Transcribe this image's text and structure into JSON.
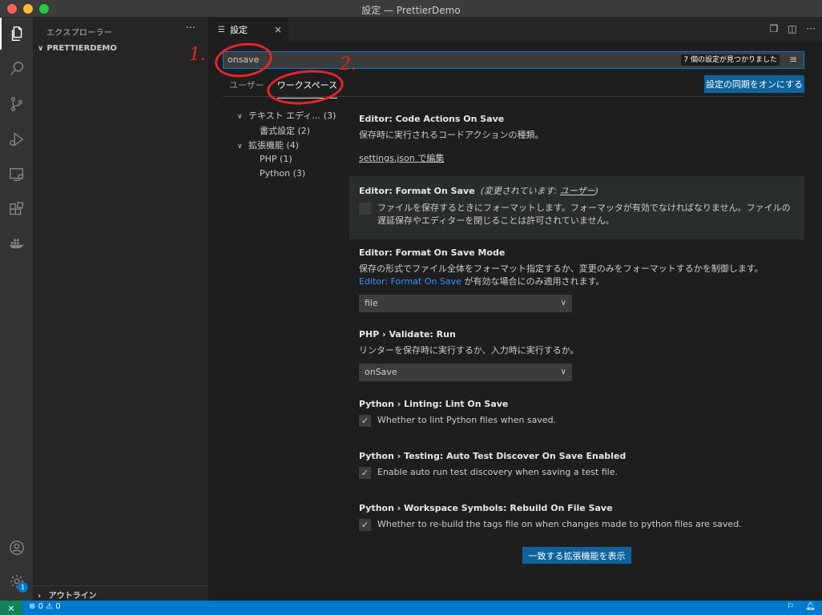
{
  "window": {
    "title": "設定 — PrettierDemo"
  },
  "sidebar": {
    "header": "エクスプローラー",
    "more": "···",
    "project": "PRETTIERDEMO",
    "outline": "アウトライン"
  },
  "activity": {
    "badge": "1"
  },
  "tab": {
    "label": "設定",
    "close": "×"
  },
  "search": {
    "value": "onsave",
    "count": "7 個の設定が見つかりました"
  },
  "scopes": {
    "user": "ユーザー",
    "workspace": "ワークスペース"
  },
  "sync_button": "設定の同期をオンにする",
  "toc": [
    {
      "label": "テキスト エディ...",
      "count": "(3)",
      "level": 0,
      "chev": "∨"
    },
    {
      "label": "書式設定 (2)",
      "level": 1
    },
    {
      "label": "拡張機能 (4)",
      "level": 0,
      "chev": "∨"
    },
    {
      "label": "PHP (1)",
      "level": 1
    },
    {
      "label": "Python (3)",
      "level": 1
    }
  ],
  "settings": {
    "s1": {
      "category": "Editor: ",
      "name": "Code Actions On Save",
      "desc": "保存時に実行されるコードアクションの種類。",
      "link": "settings.json で編集"
    },
    "s2": {
      "category": "Editor: ",
      "name": "Format On Save",
      "modified_prefix": "(変更されています: ",
      "modified_scope": "ユーザー",
      "modified_suffix": ")",
      "desc": "ファイルを保存するときにフォーマットします。フォーマッタが有効でなければなりません。ファイルの遅延保存やエディターを閉じることは許可されていません。"
    },
    "s3": {
      "category": "Editor: ",
      "name": "Format On Save Mode",
      "desc_a": "保存の形式でファイル全体をフォーマット指定するか、変更のみをフォーマットするかを制御します。",
      "desc_link": "Editor: Format On Save",
      "desc_b": " が有効な場合にのみ適用されます。",
      "value": "file"
    },
    "s4": {
      "category": "PHP › Validate: ",
      "name": "Run",
      "desc": "リンターを保存時に実行するか、入力時に実行するか。",
      "value": "onSave"
    },
    "s5": {
      "category": "Python › Linting: ",
      "name": "Lint On Save",
      "desc": "Whether to lint Python files when saved.",
      "checked": true
    },
    "s6": {
      "category": "Python › Testing: ",
      "name": "Auto Test Discover On Save Enabled",
      "desc": "Enable auto run test discovery when saving a test file.",
      "checked": true
    },
    "s7": {
      "category": "Python › Workspace Symbols: ",
      "name": "Rebuild On File Save",
      "desc": "Whether to re-build the tags file on when changes made to python files are saved.",
      "checked": true
    }
  },
  "show_extensions_button": "一致する拡張機能を表示",
  "annotations": {
    "one": "1.",
    "two": "2."
  },
  "status": {
    "errors": "0",
    "warnings": "0"
  },
  "colors": {
    "accent": "#007acc",
    "button": "#0e639c",
    "annotation": "#e8232a"
  }
}
